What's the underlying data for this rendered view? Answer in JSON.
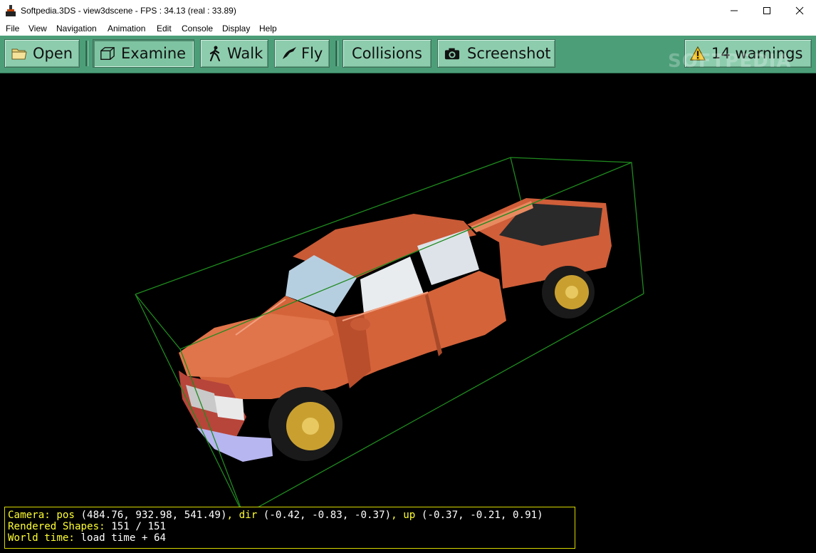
{
  "window": {
    "title": "Softpedia.3DS - view3dscene - FPS : 34.13 (real : 33.89)",
    "controls": [
      "minimize-icon",
      "maximize-icon",
      "close-icon"
    ]
  },
  "menu": [
    "File",
    "View",
    "Navigation",
    "Animation",
    "Edit",
    "Console",
    "Display",
    "Help"
  ],
  "toolbar": {
    "open": "Open",
    "examine": "Examine",
    "walk": "Walk",
    "fly": "Fly",
    "collisions": "Collisions",
    "screenshot": "Screenshot",
    "warnings": "14 warnings"
  },
  "watermark": "SOFTPEDIA",
  "status": {
    "camera_label": "Camera:",
    "pos_label": "pos",
    "pos_value": "(484.76, 932.98, 541.49)",
    "dir_label": "dir",
    "dir_value": "(-0.42, -0.83, -0.37)",
    "up_label": "up",
    "up_value": "(-0.37, -0.21, 0.91)",
    "shapes_label": "Rendered Shapes:",
    "shapes_value": "151 / 151",
    "time_label": "World time:",
    "time_value": "load time + 64"
  },
  "colors": {
    "toolbar_bg": "#4c9e79",
    "button_bg": "#8dcdae",
    "status_key": "#ffff30",
    "bbox_line": "#1f8a1f",
    "truck_body": "#d2603a"
  }
}
